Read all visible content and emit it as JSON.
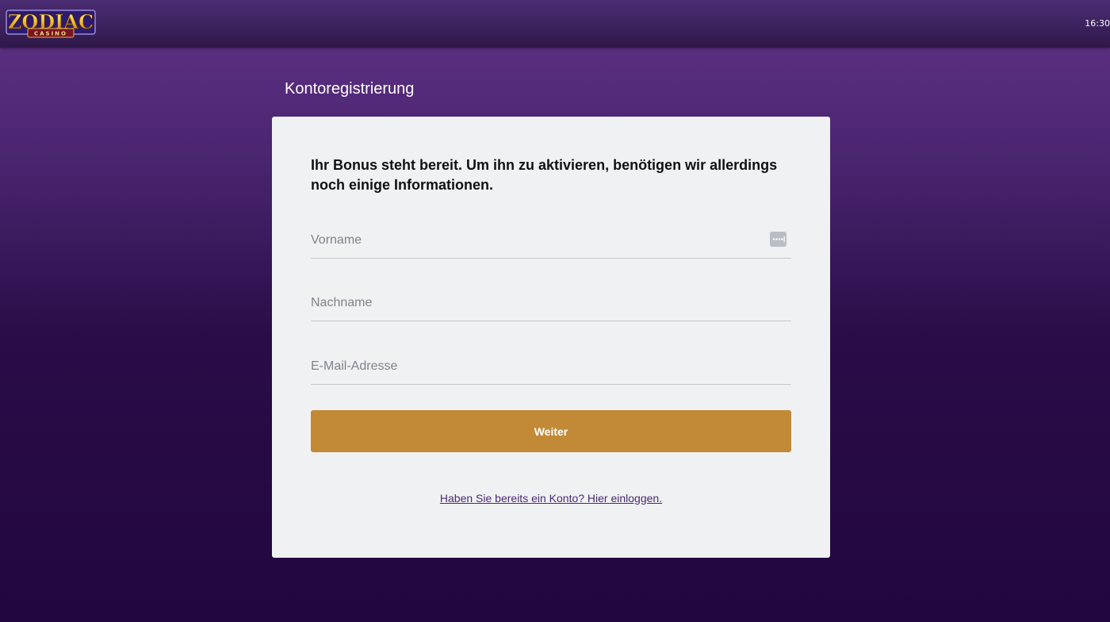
{
  "header": {
    "logo": {
      "main_text": "ZODIAC",
      "sub_text": "CASINO"
    },
    "clock": "16:30"
  },
  "page": {
    "title": "Kontoregistrierung"
  },
  "form": {
    "intro": "Ihr Bonus steht bereit. Um ihn zu aktivieren, benötigen wir allerdings noch einige Informationen.",
    "first_name": {
      "value": "",
      "placeholder": "Vorname"
    },
    "last_name": {
      "value": "",
      "placeholder": "Nachname"
    },
    "email": {
      "value": "",
      "placeholder": "E-Mail-Adresse"
    },
    "submit_label": "Weiter",
    "login_link": "Haben Sie bereits ein Konto? Hier einloggen."
  },
  "icons": {
    "autofill": "password-manager-icon"
  },
  "colors": {
    "accent_button": "#c28a37",
    "header_bg": "#3b215c",
    "background_top": "#5a2e80",
    "background_bottom": "#22063f",
    "card_bg": "#f0f1f3",
    "link": "#4a2a74"
  }
}
